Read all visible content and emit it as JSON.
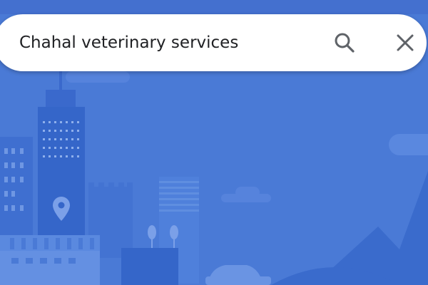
{
  "search": {
    "query": "Chahal veterinary services",
    "search_icon": "search-icon",
    "close_icon": "close-icon"
  },
  "background": {
    "illustration": "city-skyline-illustration",
    "pin_icon": "location-pin-icon",
    "colors": {
      "sky": "#4a7ad6",
      "buildings": "#3f6fd0",
      "buildings_dark": "#3566c9",
      "windows": "#6f97e3",
      "clouds": "#5b87dd"
    }
  }
}
